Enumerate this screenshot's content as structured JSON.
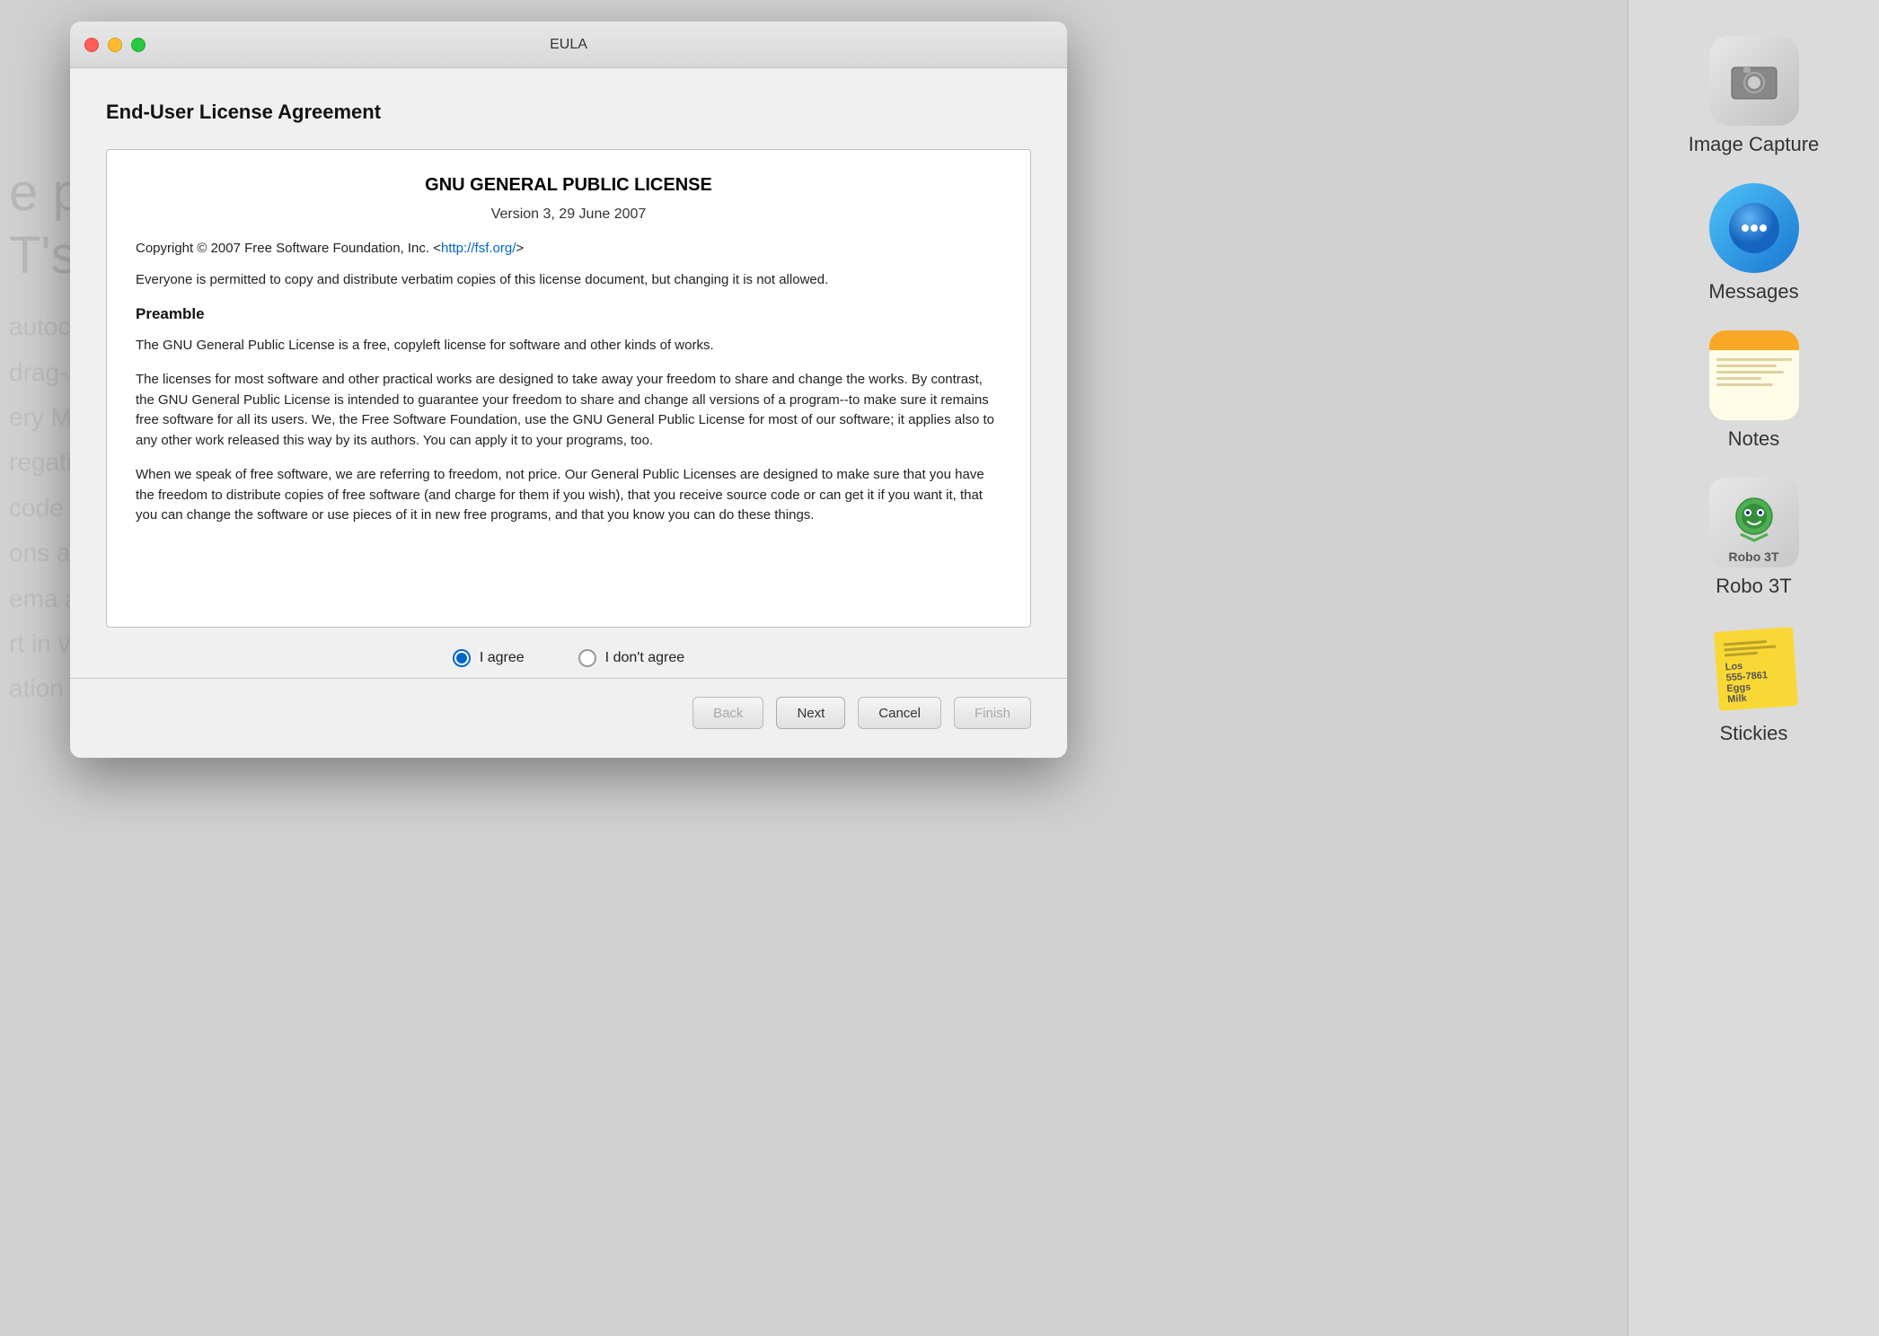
{
  "window": {
    "title": "EULA",
    "heading": "End-User License Agreement",
    "titlebar_close": "close",
    "titlebar_minimize": "minimize",
    "titlebar_maximize": "maximize"
  },
  "license": {
    "title": "GNU GENERAL PUBLIC LICENSE",
    "version": "Version 3, 29 June 2007",
    "copyright": "Copyright © 2007 Free Software Foundation, Inc. <",
    "copyright_link": "http://fsf.org/",
    "copyright_end": ">",
    "distribute_text": "Everyone is permitted to copy and distribute verbatim copies of this license document, but changing it is not allowed.",
    "preamble_heading": "Preamble",
    "preamble_p1": "The GNU General Public License is a free, copyleft license for software and other kinds of works.",
    "preamble_p2": "The licenses for most software and other practical works are designed to take away your freedom to share and change the works. By contrast, the GNU General Public License is intended to guarantee your freedom to share and change all versions of a program--to make sure it remains free software for all its users. We, the Free Software Foundation, use the GNU General Public License for most of our software; it applies also to any other work released this way by its authors. You can apply it to your programs, too.",
    "preamble_p3": "When we speak of free software, we are referring to freedom, not price. Our General Public Licenses are designed to make sure that you have the freedom to distribute copies of free software (and charge for them if you wish), that you receive source code or can get it if you want it, that you can change the software or use pieces of it in new free programs, and that you know you can do these things."
  },
  "radio": {
    "agree_label": "I agree",
    "disagree_label": "I don't agree",
    "selected": "agree"
  },
  "buttons": {
    "back": "Back",
    "next": "Next",
    "cancel": "Cancel",
    "finish": "Finish"
  },
  "sidebar": {
    "items": [
      {
        "name": "Image Capture",
        "icon": "📷"
      },
      {
        "name": "Messages",
        "icon": "💬"
      },
      {
        "name": "Notes",
        "icon": "notes"
      },
      {
        "name": "Robo 3T",
        "icon": "🤖"
      },
      {
        "name": "Stickies",
        "icon": "stickies"
      }
    ]
  },
  "bg_text_lines": [
    "e po",
    "T's s",
    "",
    "autoco",
    "drag-a",
    "ery Mo",
    "regatio",
    "code in",
    "ons a",
    "ema a",
    "t in va",
    "ation w"
  ]
}
